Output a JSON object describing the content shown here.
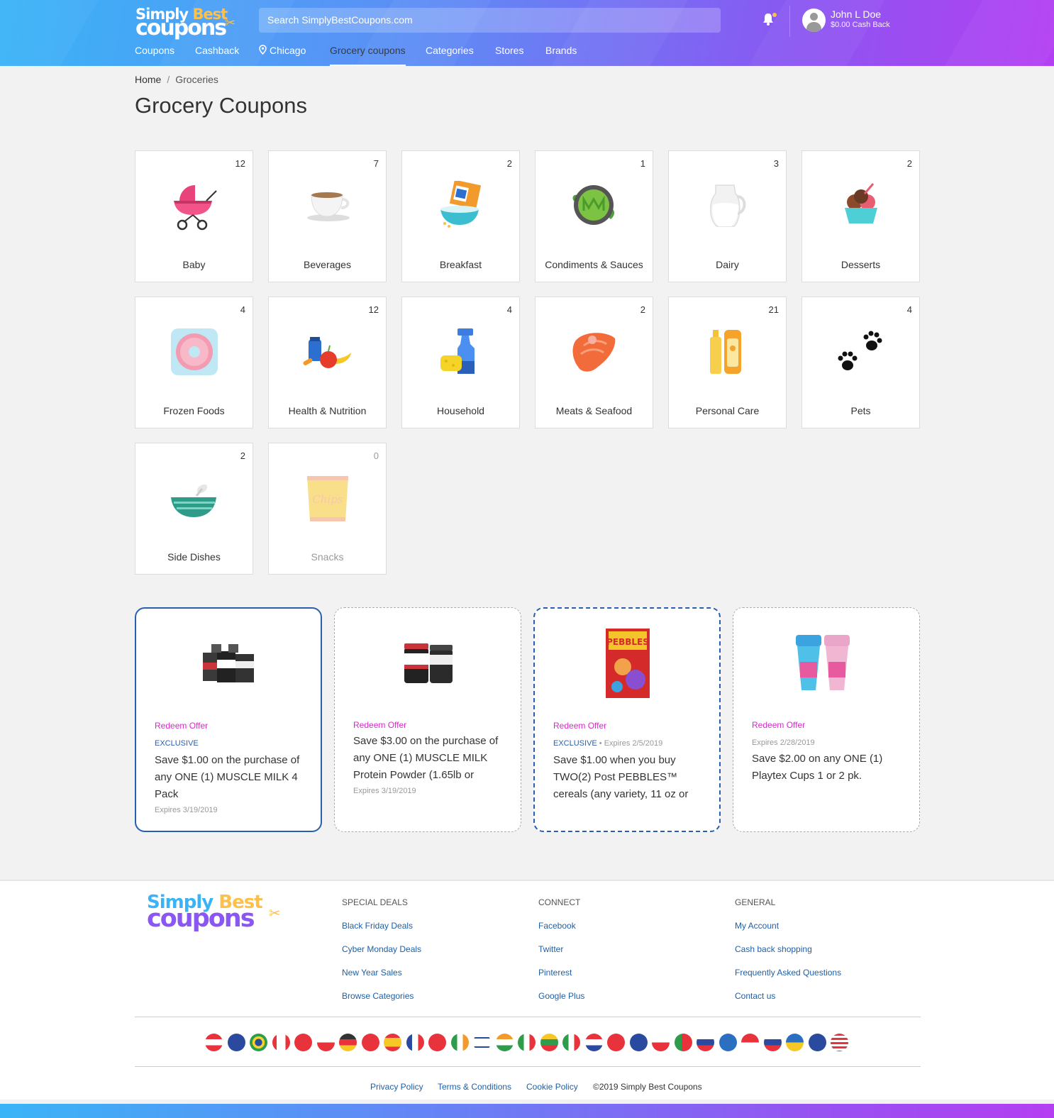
{
  "header": {
    "logo_line1": "Simply",
    "logo_line1b": "Best",
    "logo_line2": "coupons",
    "search_placeholder": "Search SimplyBestCoupons.com",
    "user_name": "John L Doe",
    "user_cash": "$0.00 Cash Back",
    "nav": [
      "Coupons",
      "Cashback",
      "Chicago",
      "Grocery coupons",
      "Categories",
      "Stores",
      "Brands"
    ],
    "active_nav": "Grocery coupons",
    "brand_colors": {
      "gradient_start": "#3ab4f7",
      "gradient_end": "#b43ff2",
      "accent": "#fdc04b"
    }
  },
  "breadcrumb": {
    "home": "Home",
    "sep": "/",
    "current": "Groceries"
  },
  "page_title": "Grocery Coupons",
  "categories": [
    {
      "name": "Baby",
      "count": "12",
      "icon": "stroller-icon"
    },
    {
      "name": "Beverages",
      "count": "7",
      "icon": "coffee-cup-icon"
    },
    {
      "name": "Breakfast",
      "count": "2",
      "icon": "cereal-bowl-icon"
    },
    {
      "name": "Condiments & Sauces",
      "count": "1",
      "icon": "sauce-bowl-icon"
    },
    {
      "name": "Dairy",
      "count": "3",
      "icon": "milk-jug-icon"
    },
    {
      "name": "Desserts",
      "count": "2",
      "icon": "ice-cream-icon"
    },
    {
      "name": "Frozen Foods",
      "count": "4",
      "icon": "frozen-donut-icon"
    },
    {
      "name": "Health & Nutrition",
      "count": "12",
      "icon": "fruit-vitamins-icon"
    },
    {
      "name": "Household",
      "count": "4",
      "icon": "spray-sponge-icon"
    },
    {
      "name": "Meats & Seafood",
      "count": "2",
      "icon": "salmon-steak-icon"
    },
    {
      "name": "Personal Care",
      "count": "21",
      "icon": "lotion-bottles-icon"
    },
    {
      "name": "Pets",
      "count": "4",
      "icon": "paw-prints-icon"
    },
    {
      "name": "Side Dishes",
      "count": "2",
      "icon": "mixing-bowl-icon"
    },
    {
      "name": "Snacks",
      "count": "0",
      "icon": "chips-bag-icon"
    }
  ],
  "offers": [
    {
      "redeem": "Redeem Offer",
      "exclusive": "EXCLUSIVE",
      "expires": "Expires 3/19/2019",
      "desc": "Save $1.00 on the purchase of any ONE (1) MUSCLE MILK 4 Pack",
      "image": "muscle-milk-4pack-image"
    },
    {
      "redeem": "Redeem Offer",
      "exclusive": "",
      "expires": "Expires 3/19/2019",
      "desc": "Save $3.00 on the purchase of any ONE (1) MUSCLE MILK Protein Powder (1.65lb or",
      "image": "muscle-milk-powder-image"
    },
    {
      "redeem": "Redeem Offer",
      "exclusive": "EXCLUSIVE",
      "expires": "Expires 2/5/2019",
      "desc": "Save $1.00 when you buy TWO(2) Post PEBBLES™ cereals (any variety, 11 oz or",
      "image": "fruity-pebbles-image"
    },
    {
      "redeem": "Redeem Offer",
      "exclusive": "",
      "expires": "Expires 2/28/2019",
      "desc": "Save $2.00 on any ONE (1) Playtex Cups 1 or 2 pk.",
      "image": "playtex-cups-image"
    }
  ],
  "footer": {
    "columns": [
      {
        "heading": "SPECIAL DEALS",
        "links": [
          "Black Friday Deals",
          "Cyber Monday Deals",
          "New Year Sales",
          "Browse Categories"
        ]
      },
      {
        "heading": "CONNECT",
        "links": [
          "Facebook",
          "Twitter",
          "Pinterest",
          "Google Plus"
        ]
      },
      {
        "heading": "GENERAL",
        "links": [
          "My Account",
          "Cash back shopping",
          "Frequently Asked Questions",
          "Contact us"
        ]
      }
    ],
    "bottom_links": [
      "Privacy Policy",
      "Terms & Conditions",
      "Cookie Policy"
    ],
    "copyright": "©2019 Simply Best Coupons",
    "flags": [
      "austria-flag-icon",
      "australia-flag-icon",
      "brazil-flag-icon",
      "canada-flag-icon",
      "switzerland-flag-icon",
      "czech-flag-icon",
      "germany-flag-icon",
      "denmark-flag-icon",
      "spain-flag-icon",
      "france-flag-icon",
      "hong-kong-flag-icon",
      "ireland-flag-icon",
      "israel-flag-icon",
      "india-flag-icon",
      "italy-flag-icon",
      "lithuania-flag-icon",
      "mexico-flag-icon",
      "netherlands-flag-icon",
      "norway-flag-icon",
      "new-zealand-flag-icon",
      "poland-flag-icon",
      "portugal-flag-icon",
      "russia-flag-icon",
      "sweden-flag-icon",
      "singapore-flag-icon",
      "slovakia-flag-icon",
      "ukraine-flag-icon",
      "uk-flag-icon",
      "usa-flag-icon"
    ]
  }
}
